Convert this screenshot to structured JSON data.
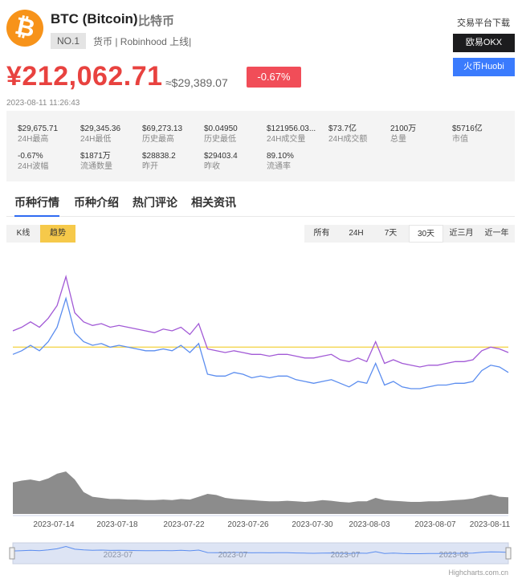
{
  "coin": {
    "symbol_icon": "bitcoin-logo-icon",
    "name": "BTC (Bitcoin)",
    "cn_name": "比特币",
    "rank": "NO.1",
    "tags": "货币 | Robinhood 上线|"
  },
  "download": {
    "title": "交易平台下载",
    "okx_label": "欧易OKX",
    "huobi_label": "火币Huobi"
  },
  "price": {
    "cny": "¥212,062.71",
    "usd": "≈$29,389.07",
    "change": "-0.67%",
    "timestamp": "2023-08-11 11:26:43"
  },
  "stats": [
    {
      "value": "$29,675.71",
      "label": "24H最高"
    },
    {
      "value": "$29,345.36",
      "label": "24H最低"
    },
    {
      "value": "$69,273.13",
      "label": "历史最高"
    },
    {
      "value": "$0.04950",
      "label": "历史最低"
    },
    {
      "value": "$121956.03...",
      "label": "24H成交量"
    },
    {
      "value": "$73.7亿",
      "label": "24H成交额"
    },
    {
      "value": "2100万",
      "label": "总量"
    },
    {
      "value": "$5716亿",
      "label": "市值"
    },
    {
      "value": "-0.67%",
      "label": "24H波幅"
    },
    {
      "value": "$1871万",
      "label": "流通数量"
    },
    {
      "value": "$28838.2",
      "label": "昨开"
    },
    {
      "value": "$29403.4",
      "label": "昨收"
    },
    {
      "value": "89.10%",
      "label": "流通率"
    }
  ],
  "tabs": [
    "币种行情",
    "币种介绍",
    "热门评论",
    "相关资讯"
  ],
  "chart_modes": [
    "K线",
    "趋势"
  ],
  "ranges": [
    "所有",
    "24H",
    "7天",
    "30天",
    "近三月",
    "近一年"
  ],
  "active_range": "30天",
  "colors": {
    "price_up_red": "#e8423f",
    "purple_series": "#a25ad6",
    "blue_series": "#5b8def",
    "yellow_line": "#f3d23f",
    "volume_gray": "#8c8c8c",
    "huobi_blue": "#3a7bfd",
    "okx_dark": "#1c1c1e",
    "bitcoin_orange": "#f7931a"
  },
  "chart_data": {
    "type": "line",
    "x_labels": [
      "2023-07-14",
      "2023-07-18",
      "2023-07-22",
      "2023-07-26",
      "2023-07-30",
      "2023-08-03",
      "2023-08-07",
      "2023-08-11"
    ],
    "navigator_labels": [
      "2023-07",
      "2023-07",
      "2023-07",
      "2023-08",
      "2023-08"
    ],
    "credit": "Highcharts.com.cn",
    "series": [
      {
        "color": "purple",
        "values": [
          68,
          70,
          73,
          70,
          75,
          82,
          98,
          78,
          73,
          71,
          72,
          70,
          71,
          70,
          69,
          68,
          67,
          69,
          68,
          70,
          66,
          72,
          58,
          57,
          56,
          57,
          56,
          55,
          55,
          54,
          55,
          55,
          54,
          53,
          53,
          54,
          55,
          52,
          51,
          53,
          51,
          62,
          50,
          52,
          50,
          49,
          48,
          49,
          49,
          50,
          51,
          51,
          52,
          57,
          59,
          58,
          56
        ]
      },
      {
        "color": "blue",
        "values": [
          55,
          57,
          60,
          57,
          62,
          70,
          86,
          67,
          62,
          60,
          61,
          59,
          60,
          59,
          58,
          57,
          57,
          58,
          57,
          60,
          56,
          61,
          44,
          43,
          43,
          45,
          44,
          42,
          43,
          42,
          43,
          43,
          41,
          40,
          39,
          40,
          41,
          39,
          37,
          40,
          39,
          50,
          38,
          40,
          37,
          36,
          36,
          37,
          38,
          38,
          39,
          39,
          40,
          46,
          49,
          48,
          45
        ]
      },
      {
        "color": "yellow",
        "values": [
          59,
          59
        ]
      }
    ],
    "volume": [
      55,
      58,
      60,
      57,
      62,
      70,
      74,
      60,
      38,
      30,
      28,
      26,
      26,
      25,
      25,
      24,
      24,
      25,
      24,
      26,
      25,
      30,
      35,
      33,
      28,
      26,
      25,
      24,
      23,
      22,
      22,
      23,
      22,
      21,
      22,
      24,
      23,
      21,
      20,
      22,
      22,
      28,
      24,
      23,
      22,
      21,
      21,
      22,
      22,
      23,
      24,
      25,
      27,
      31,
      34,
      30,
      29
    ]
  }
}
